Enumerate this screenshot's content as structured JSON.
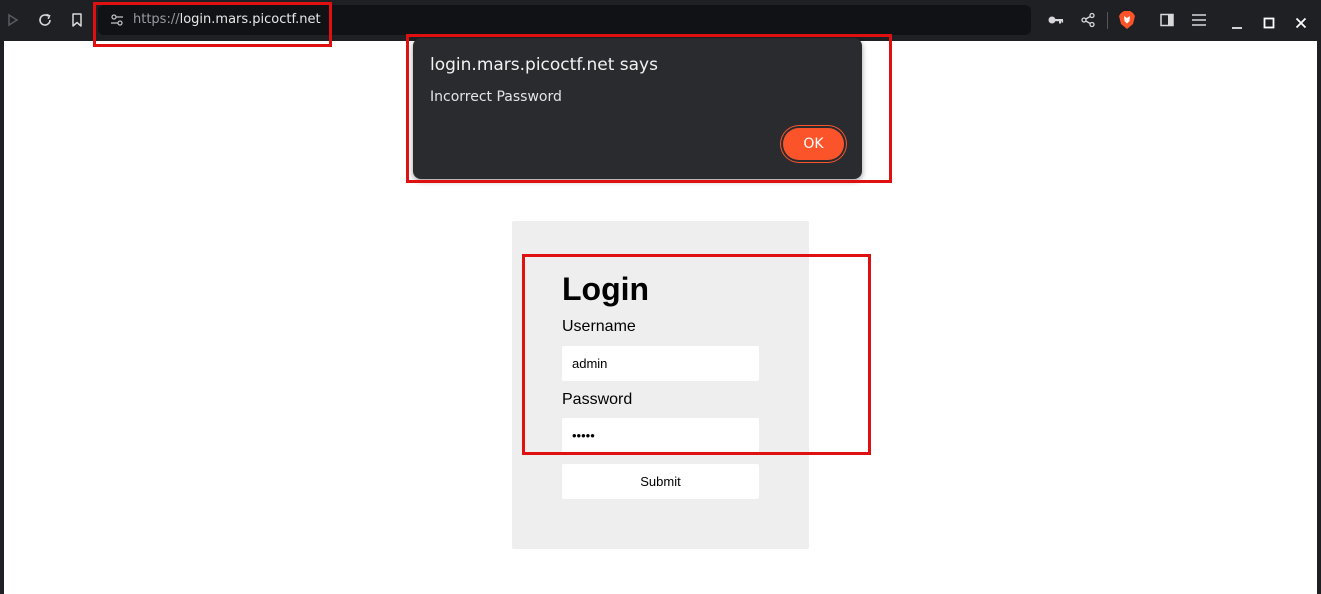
{
  "browser": {
    "url_scheme": "https://",
    "url_host": "login.mars.picoctf.net",
    "icons": [
      "play-icon",
      "reload-icon",
      "bookmark-icon",
      "site-info-icon",
      "key-icon",
      "share-icon",
      "brave-shield-icon",
      "sidebar-icon",
      "menu-icon",
      "minimize-icon",
      "maximize-icon",
      "close-icon"
    ]
  },
  "dialog": {
    "title": "login.mars.picoctf.net says",
    "message": "Incorrect Password",
    "ok_label": "OK"
  },
  "login": {
    "title": "Login",
    "username_label": "Username",
    "username_value": "admin",
    "password_label": "Password",
    "password_value": "•••••",
    "submit_label": "Submit"
  },
  "colors": {
    "accent": "#fb542b",
    "annotation": "#e01010",
    "card_bg": "#eeeeee"
  }
}
